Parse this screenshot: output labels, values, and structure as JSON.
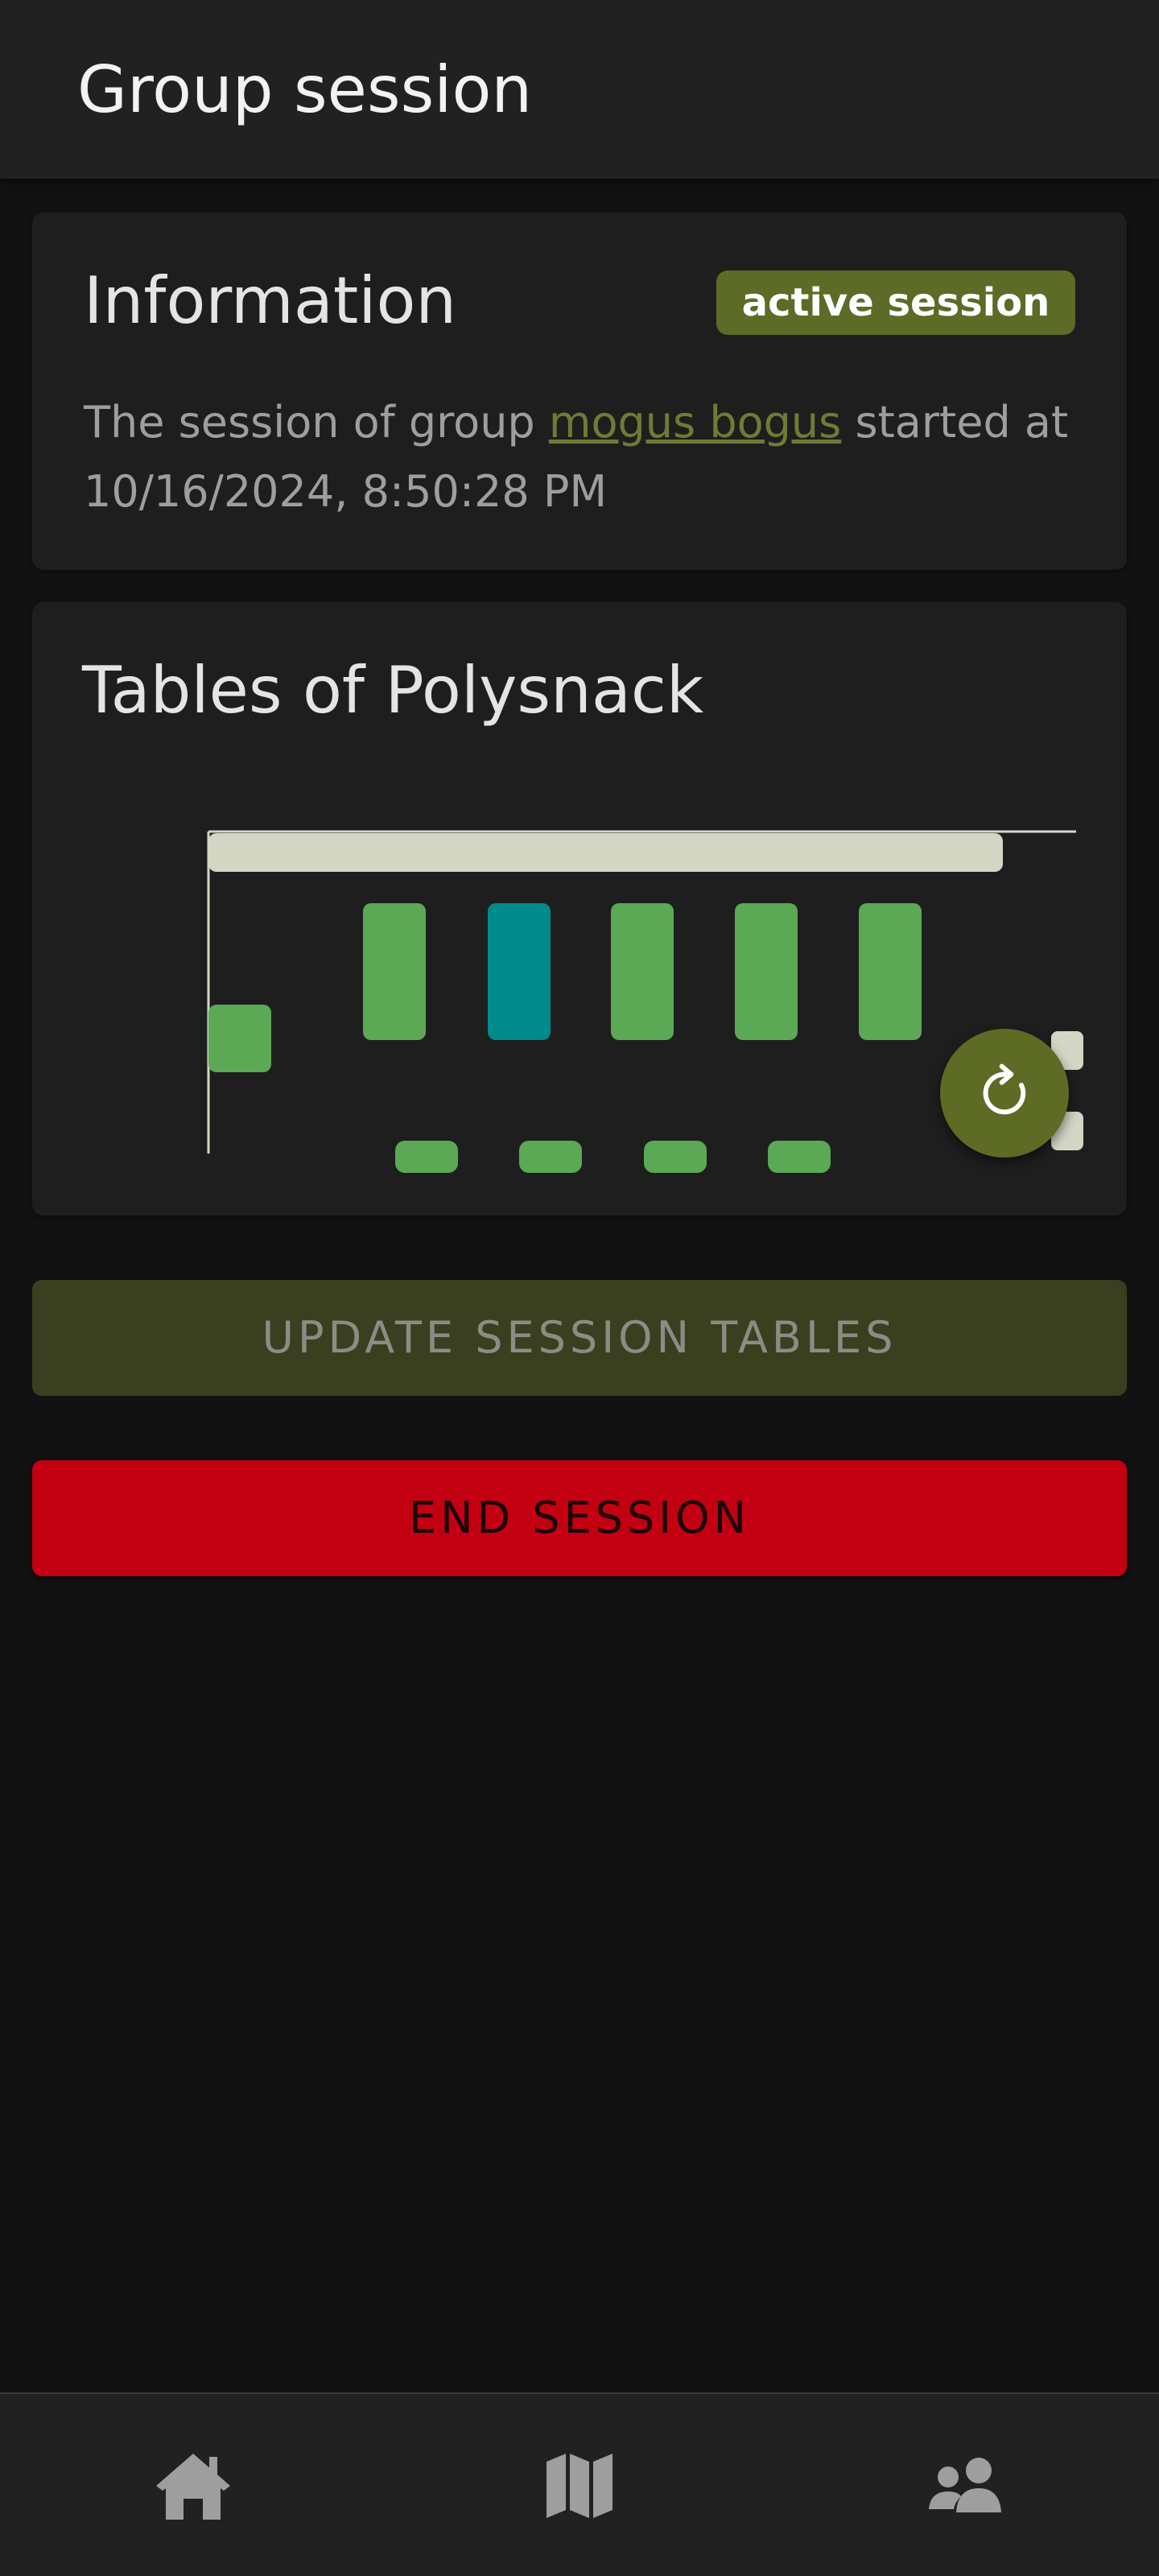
{
  "app_bar": {
    "title": "Group session"
  },
  "information": {
    "heading": "Information",
    "status_badge": "active session",
    "text_before": "The session of group ",
    "group_name": "mogus bogus",
    "text_after": " started at 10/16/2024, 8:50:28 PM"
  },
  "tables": {
    "heading": "Tables of Polysnack"
  },
  "colors": {
    "accent": "#5c6b26",
    "free_table": "#5ba855",
    "selected_table": "#008b8b",
    "wall": "#d4d6c4",
    "danger": "#c20012"
  },
  "actions": {
    "update_label": "UPDATE SESSION TABLES",
    "end_label": "END SESSION",
    "refresh_icon": "refresh-icon"
  },
  "nav": {
    "items": [
      {
        "icon": "home-icon"
      },
      {
        "icon": "map-icon"
      },
      {
        "icon": "groups-icon"
      }
    ]
  }
}
